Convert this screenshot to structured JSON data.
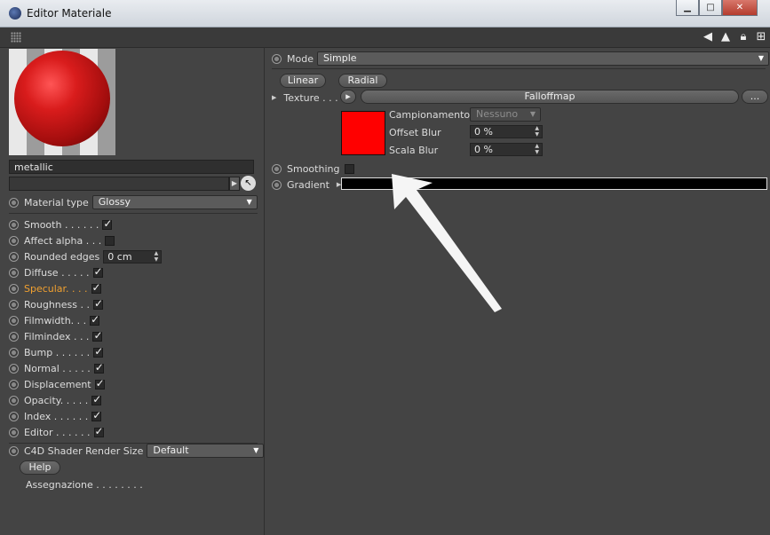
{
  "window": {
    "title": "Editor Materiale",
    "minimize": "▁",
    "maximize": "□",
    "close": "✕"
  },
  "toolbar": {
    "icons": [
      "back-arrow-icon",
      "up-arrow-icon",
      "lock-icon",
      "new-panel-icon"
    ]
  },
  "material": {
    "name": "metallic",
    "path": "",
    "type_label": "Material type",
    "type_value": "Glossy",
    "params": [
      {
        "label": "Smooth . . . . . .",
        "checked": true
      },
      {
        "label": "Affect alpha . . .",
        "checked": false
      },
      {
        "label": "Rounded edges",
        "value": "0 cm"
      },
      {
        "label": "Diffuse . . . . .",
        "checked": true
      },
      {
        "label": "Specular. . . .",
        "checked": true,
        "active": true
      },
      {
        "label": "Roughness . .",
        "checked": true
      },
      {
        "label": "Filmwidth. . .",
        "checked": true
      },
      {
        "label": "Filmindex . . .",
        "checked": true
      },
      {
        "label": "Bump . . . . . .",
        "checked": true
      },
      {
        "label": "Normal . . . . .",
        "checked": true
      },
      {
        "label": "Displacement",
        "checked": true
      },
      {
        "label": "Opacity. . . . .",
        "checked": true
      },
      {
        "label": "Index . . . . . .",
        "checked": true
      },
      {
        "label": "Editor . . . . . .",
        "checked": true
      }
    ],
    "shader_size_label": "C4D Shader Render Size",
    "shader_size_value": "Default",
    "help_label": "Help",
    "assign_label": "Assegnazione . . . . . . . ."
  },
  "shader": {
    "mode_label": "Mode",
    "mode_value": "Simple",
    "linear_label": "Linear",
    "radial_label": "Radial",
    "texture_label": "Texture . . .",
    "texture_value": "Falloffmap",
    "more_label": "...",
    "sampling_label": "Campionamento",
    "sampling_value": "Nessuno",
    "offset_blur_label": "Offset Blur",
    "offset_blur_value": "0 %",
    "scale_blur_label": "Scala Blur",
    "scale_blur_value": "0 %",
    "smoothing_label": "Smoothing",
    "smoothing_checked": false,
    "gradient_label": "Gradient",
    "swatch_color": "#ff0000"
  }
}
